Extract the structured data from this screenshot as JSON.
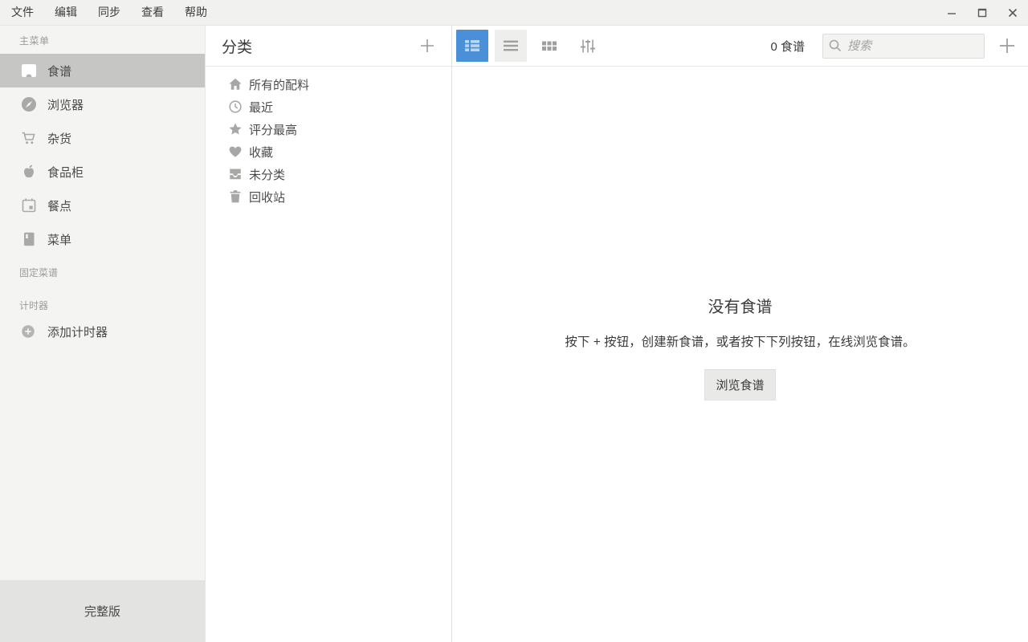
{
  "menubar": {
    "items": [
      "文件",
      "编辑",
      "同步",
      "查看",
      "帮助"
    ]
  },
  "window_controls": {
    "minimize": "minimize",
    "maximize": "maximize",
    "close": "close"
  },
  "sidebar": {
    "section_main": "主菜单",
    "items": [
      {
        "label": "食谱",
        "icon": "recipe-icon",
        "selected": true
      },
      {
        "label": "浏览器",
        "icon": "compass-icon",
        "selected": false
      },
      {
        "label": "杂货",
        "icon": "cart-icon",
        "selected": false
      },
      {
        "label": "食品柜",
        "icon": "apple-icon",
        "selected": false
      },
      {
        "label": "餐点",
        "icon": "calendar-icon",
        "selected": false
      },
      {
        "label": "菜单",
        "icon": "book-icon",
        "selected": false
      }
    ],
    "section_pinned": "固定菜谱",
    "section_timers": "计时器",
    "add_timer_label": "添加计时器",
    "footer_label": "完整版"
  },
  "categories": {
    "title": "分类",
    "items": [
      {
        "label": "所有的配料",
        "icon": "home-icon"
      },
      {
        "label": "最近",
        "icon": "clock-icon"
      },
      {
        "label": "评分最高",
        "icon": "star-icon"
      },
      {
        "label": "收藏",
        "icon": "heart-icon"
      },
      {
        "label": "未分类",
        "icon": "inbox-icon"
      },
      {
        "label": "回收站",
        "icon": "trash-icon"
      }
    ]
  },
  "toolbar": {
    "count": "0 食谱",
    "search_placeholder": "搜索",
    "views": [
      "detail-list",
      "list",
      "grid",
      "filters"
    ]
  },
  "empty_state": {
    "title": "没有食谱",
    "description": "按下 + 按钮，创建新食谱，或者按下下列按钮，在线浏览食谱。",
    "browse_button": "浏览食谱"
  },
  "colors": {
    "accent": "#4a90d8",
    "selected_item_bg": "#c6c6c4",
    "sidebar_bg": "#f4f4f2",
    "footer_bg": "#e3e3e1"
  }
}
